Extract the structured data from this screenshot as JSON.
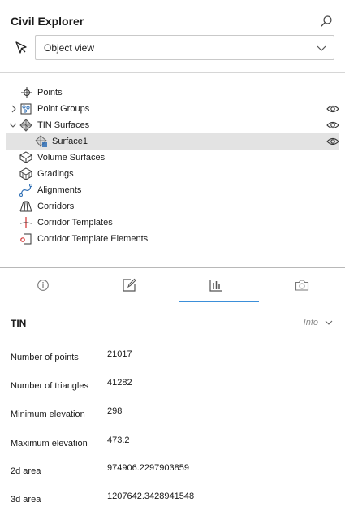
{
  "header": {
    "title": "Civil Explorer",
    "dropdown_value": "Object view"
  },
  "tree": {
    "items": [
      {
        "label": "Points",
        "icon": "point-icon",
        "has_expander": false,
        "expanded": false,
        "has_eye": false,
        "selected": false
      },
      {
        "label": "Point Groups",
        "icon": "point-groups-icon",
        "has_expander": true,
        "expanded": false,
        "has_eye": true,
        "selected": false
      },
      {
        "label": "TIN Surfaces",
        "icon": "tin-surfaces-icon",
        "has_expander": true,
        "expanded": true,
        "has_eye": true,
        "selected": false
      },
      {
        "label": "Surface1",
        "icon": "surface-icon",
        "has_expander": false,
        "expanded": false,
        "has_eye": true,
        "selected": true
      },
      {
        "label": "Volume Surfaces",
        "icon": "volume-surfaces-icon",
        "has_expander": false,
        "expanded": false,
        "has_eye": false,
        "selected": false
      },
      {
        "label": "Gradings",
        "icon": "gradings-icon",
        "has_expander": false,
        "expanded": false,
        "has_eye": false,
        "selected": false
      },
      {
        "label": "Alignments",
        "icon": "alignments-icon",
        "has_expander": false,
        "expanded": false,
        "has_eye": false,
        "selected": false
      },
      {
        "label": "Corridors",
        "icon": "corridors-icon",
        "has_expander": false,
        "expanded": false,
        "has_eye": false,
        "selected": false
      },
      {
        "label": "Corridor Templates",
        "icon": "corridor-templates-icon",
        "has_expander": false,
        "expanded": false,
        "has_eye": false,
        "selected": false
      },
      {
        "label": "Corridor Template Elements",
        "icon": "corridor-template-elements-icon",
        "has_expander": false,
        "expanded": false,
        "has_eye": false,
        "selected": false
      }
    ]
  },
  "tabs": [
    {
      "name": "info-tab",
      "icon": "info-icon",
      "active": false
    },
    {
      "name": "edit-tab",
      "icon": "edit-icon",
      "active": false
    },
    {
      "name": "statistics-tab",
      "icon": "bar-chart-icon",
      "active": true
    },
    {
      "name": "snapshot-tab",
      "icon": "camera-icon",
      "active": false
    }
  ],
  "section": {
    "title": "TIN",
    "mode": "Info"
  },
  "properties": [
    {
      "name": "Number of points",
      "value": "21017"
    },
    {
      "name": "Number of triangles",
      "value": "41282"
    },
    {
      "name": "Minimum elevation",
      "value": "298"
    },
    {
      "name": "Maximum elevation",
      "value": "473.2"
    },
    {
      "name": "2d area",
      "value": "974906.2297903859"
    },
    {
      "name": "3d area",
      "value": "1207642.3428941548"
    }
  ],
  "colors": {
    "accent": "#3b8fd9",
    "icon_blue": "#2f6fb5",
    "icon_red": "#d32f2f",
    "selected_row": "#e3e3e3"
  }
}
